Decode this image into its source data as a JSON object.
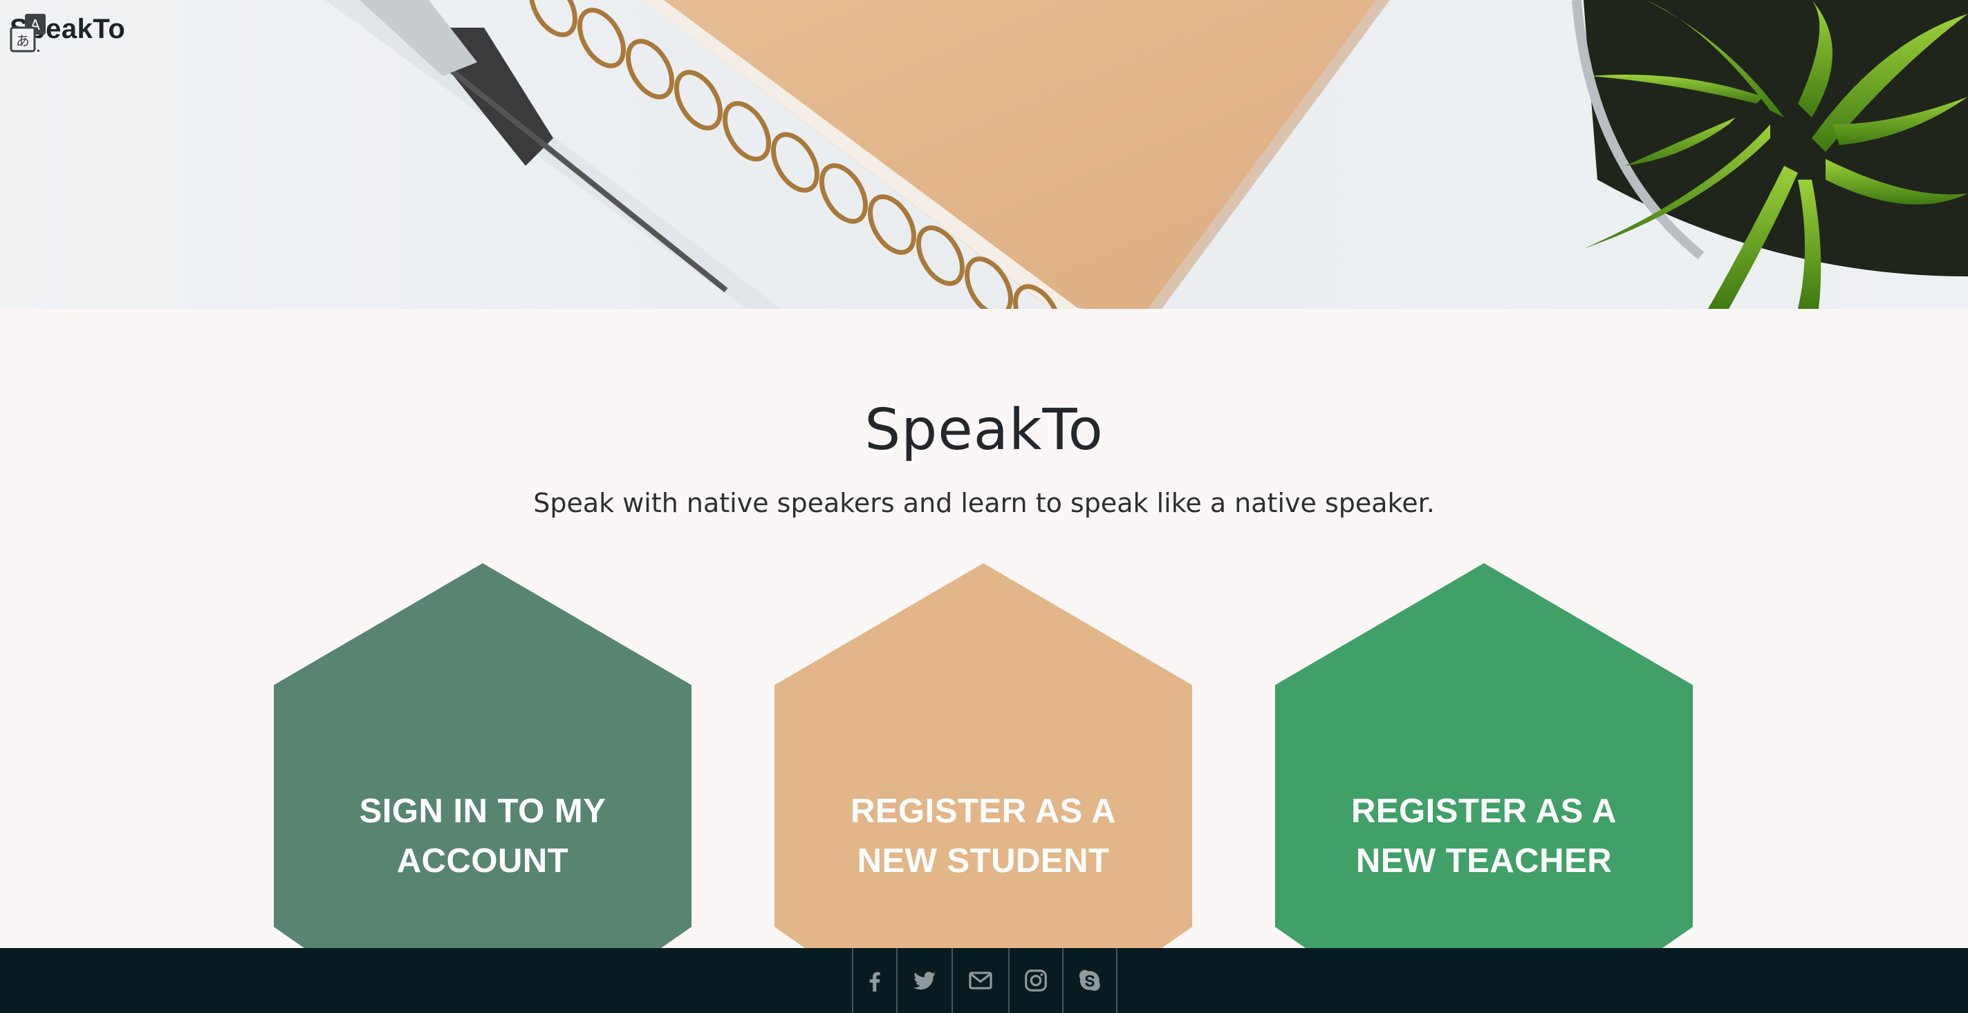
{
  "brand": {
    "name": "SpeakTo"
  },
  "hero": {
    "title": "SpeakTo",
    "subtitle": "Speak with native speakers and learn to speak like a native speaker."
  },
  "cards": [
    {
      "label": "SIGN IN TO MY ACCOUNT",
      "color": "#588570"
    },
    {
      "label": "REGISTER AS A NEW STUDENT",
      "color": "#e2b689"
    },
    {
      "label": "REGISTER AS A NEW TEACHER",
      "color": "#40a067"
    }
  ],
  "footer": {
    "background": "#081b20",
    "social_icons": [
      "facebook-icon",
      "twitter-icon",
      "mail-icon",
      "instagram-icon",
      "skype-icon"
    ]
  }
}
